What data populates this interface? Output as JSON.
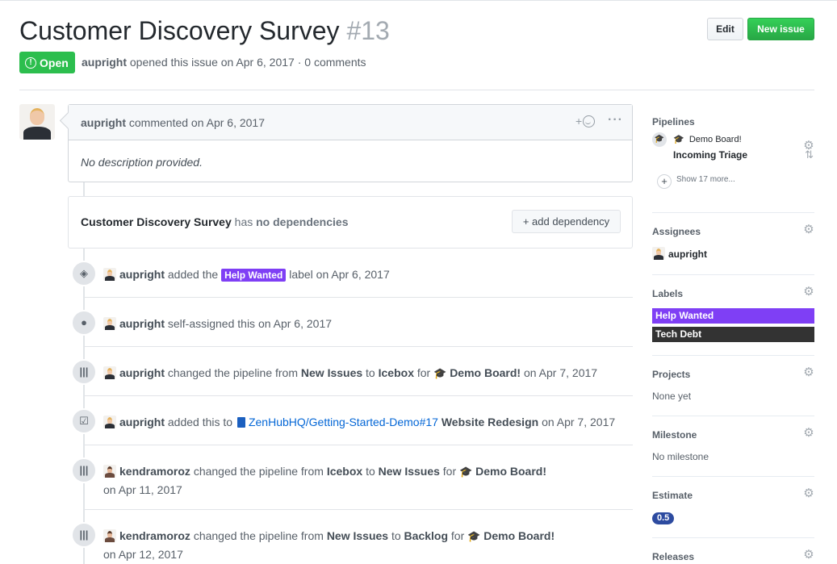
{
  "issue": {
    "title": "Customer Discovery Survey",
    "number": "#13",
    "state": "Open",
    "author": "aupright",
    "meta_rest": "opened this issue on Apr 6, 2017 · 0 comments"
  },
  "header_buttons": {
    "edit": "Edit",
    "new_issue": "New issue"
  },
  "comment": {
    "author": "aupright",
    "action": "commented on Apr 6, 2017",
    "react_plus": "+",
    "more": "···",
    "body": "No description provided."
  },
  "dependencies": {
    "issue_name": "Customer Discovery Survey",
    "has": "has",
    "status": "no dependencies",
    "button": "+ add dependency"
  },
  "events": [
    {
      "icon": "tag-icon",
      "user": "aupright",
      "pre": "added the",
      "label": "Help Wanted",
      "post": "label on Apr 6, 2017"
    },
    {
      "icon": "person-icon",
      "user": "aupright",
      "text": "self-assigned this on Apr 6, 2017"
    },
    {
      "icon": "pipeline-icon",
      "user": "aupright",
      "pre": "changed the pipeline from",
      "from": "New Issues",
      "to_word": "to",
      "to": "Icebox",
      "for": "for",
      "board": "Demo Board!",
      "date": "on Apr 7, 2017"
    },
    {
      "icon": "epic-icon",
      "user": "aupright",
      "pre": "added this to",
      "link": "ZenHubHQ/Getting-Started-Demo#17",
      "epic": "Website Redesign",
      "date": "on Apr 7, 2017"
    },
    {
      "icon": "pipeline-icon",
      "user": "kendramoroz",
      "pre": "changed the pipeline from",
      "from": "Icebox",
      "to_word": "to",
      "to": "New Issues",
      "for": "for",
      "board": "Demo Board!",
      "date": "on Apr 11, 2017"
    },
    {
      "icon": "pipeline-icon",
      "user": "kendramoroz",
      "pre": "changed the pipeline from",
      "from": "New Issues",
      "to_word": "to",
      "to": "Backlog",
      "for": "for",
      "board": "Demo Board!",
      "date": "on Apr 12, 2017"
    }
  ],
  "sidebar": {
    "pipelines": {
      "title": "Pipelines",
      "board": "Demo Board!",
      "pipeline": "Incoming Triage",
      "show_more": "Show 17 more..."
    },
    "assignees": {
      "title": "Assignees",
      "user": "aupright"
    },
    "labels": {
      "title": "Labels",
      "items": [
        "Help Wanted",
        "Tech Debt"
      ],
      "colors": [
        "#7f3ff5",
        "#333333"
      ]
    },
    "projects": {
      "title": "Projects",
      "value": "None yet"
    },
    "milestone": {
      "title": "Milestone",
      "value": "No milestone"
    },
    "estimate": {
      "title": "Estimate",
      "value": "0.5"
    },
    "releases": {
      "title": "Releases"
    }
  },
  "colors": {
    "open_green": "#2cbe4e",
    "new_issue_green": "#28a745",
    "help_wanted": "#7f3ff5",
    "tech_debt": "#333333",
    "estimate_badge": "#2d4ba0",
    "link_blue": "#0366d6"
  }
}
